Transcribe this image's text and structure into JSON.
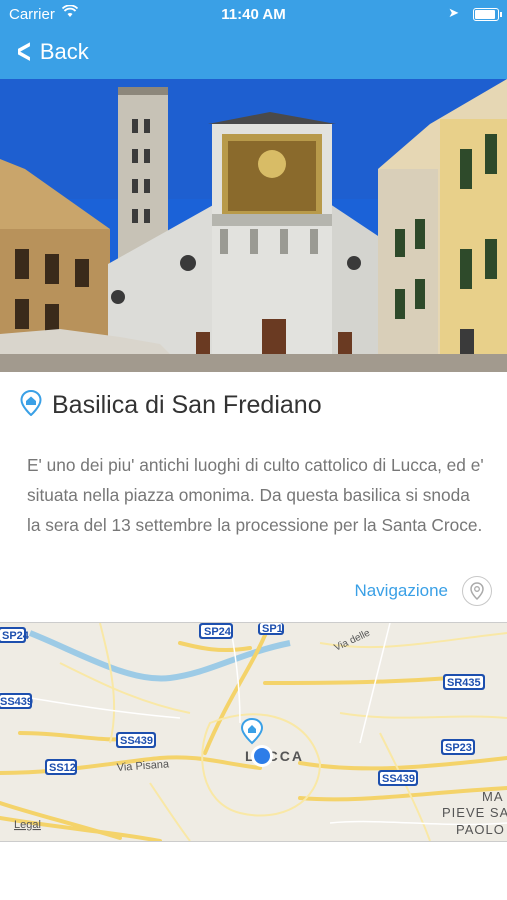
{
  "status": {
    "carrier": "Carrier",
    "time": "11:40 AM"
  },
  "header": {
    "back_label": "Back"
  },
  "poi": {
    "title": "Basilica di San Frediano",
    "description": "E' uno dei piu' antichi luoghi di culto cattolico di Lucca, ed e' situata nella piazza omonima. Da questa basilica si snoda la sera del 13 settembre la processione per la Santa Croce.",
    "navigation_label": "Navigazione"
  },
  "map": {
    "city": "LUCCA",
    "roads": [
      "SP24",
      "SP24",
      "SP1",
      "SS439",
      "SS439",
      "SS12",
      "SS439",
      "SR435",
      "SP23"
    ],
    "street": "Via Pisana",
    "street2": "Via delle",
    "place1": "MA",
    "place2": "PIEVE SA",
    "place3": "PAOLO",
    "legal": "Legal"
  },
  "colors": {
    "accent": "#3aa0e6",
    "sky": "#1b62d8"
  }
}
